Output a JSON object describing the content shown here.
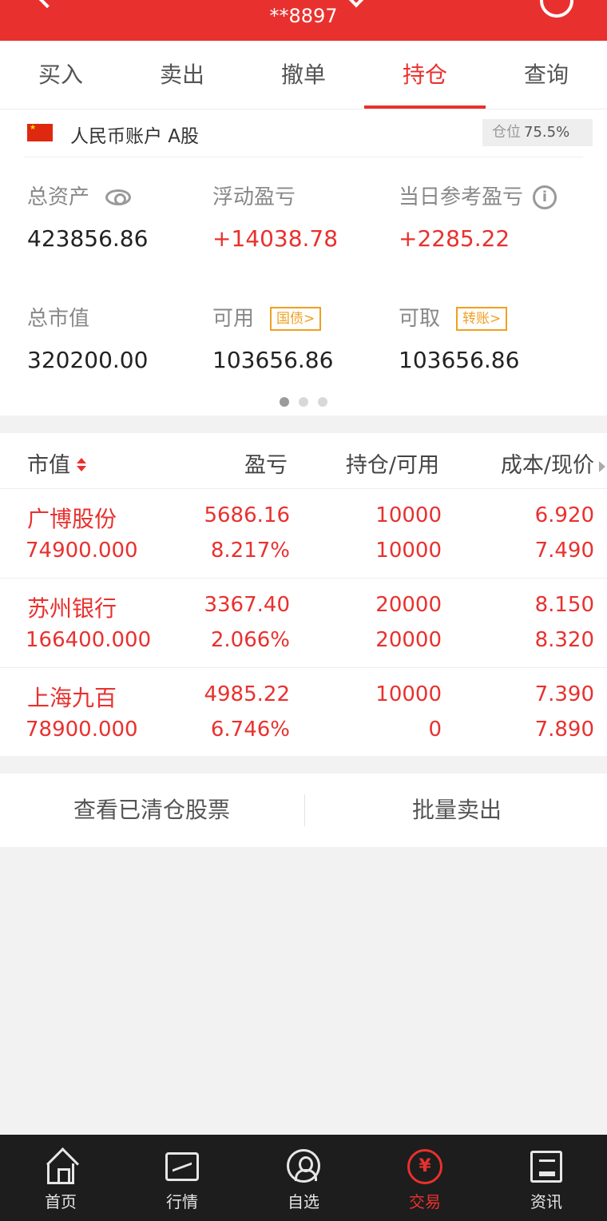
{
  "header": {
    "title": "**8897",
    "accent_color": "#e8312e",
    "icons": [
      "back-arrow-icon",
      "dropdown-caret-icon",
      "refresh-icon"
    ]
  },
  "tabs": [
    {
      "label": "买入",
      "active": false
    },
    {
      "label": "卖出",
      "active": false
    },
    {
      "label": "撤单",
      "active": false
    },
    {
      "label": "持仓",
      "active": true
    },
    {
      "label": "查询",
      "active": false
    }
  ],
  "account": {
    "name": "人民币账户 A股",
    "position_label": "仓位",
    "position_value": "75.5%"
  },
  "metrics": {
    "total_assets": {
      "label": "总资产",
      "value": "423856.86"
    },
    "floating_pl": {
      "label": "浮动盈亏",
      "value": "+14038.78"
    },
    "daily_pl": {
      "label": "当日参考盈亏",
      "value": "+2285.22"
    },
    "market_value": {
      "label": "总市值",
      "value": "320200.00"
    },
    "available": {
      "label": "可用",
      "value": "103656.86",
      "tag": "国债>"
    },
    "withdrawable": {
      "label": "可取",
      "value": "103656.86",
      "tag": "转账>"
    }
  },
  "page_indicator": {
    "count": 3,
    "active": 0
  },
  "table": {
    "headers": {
      "market_value": "市值",
      "profit_loss": "盈亏",
      "holding_available": "持仓/可用",
      "cost_price": "成本/现价"
    },
    "rows": [
      {
        "name": "广博股份",
        "market_value": "74900.000",
        "pl": "5686.16",
        "pl_pct": "8.217%",
        "holding": "10000",
        "available": "10000",
        "cost": "6.920",
        "price": "7.490"
      },
      {
        "name": "苏州银行",
        "market_value": "166400.000",
        "pl": "3367.40",
        "pl_pct": "2.066%",
        "holding": "20000",
        "available": "20000",
        "cost": "8.150",
        "price": "8.320"
      },
      {
        "name": "上海九百",
        "market_value": "78900.000",
        "pl": "4985.22",
        "pl_pct": "6.746%",
        "holding": "10000",
        "available": "0",
        "cost": "7.390",
        "price": "7.890"
      }
    ]
  },
  "actions": {
    "view_cleared": "查看已清仓股票",
    "batch_sell": "批量卖出"
  },
  "bottom_nav": [
    {
      "label": "首页",
      "icon": "home-icon",
      "active": false
    },
    {
      "label": "行情",
      "icon": "chart-icon",
      "active": false
    },
    {
      "label": "自选",
      "icon": "user-icon",
      "active": false
    },
    {
      "label": "交易",
      "icon": "yen-icon",
      "active": true
    },
    {
      "label": "资讯",
      "icon": "news-icon",
      "active": false
    }
  ]
}
